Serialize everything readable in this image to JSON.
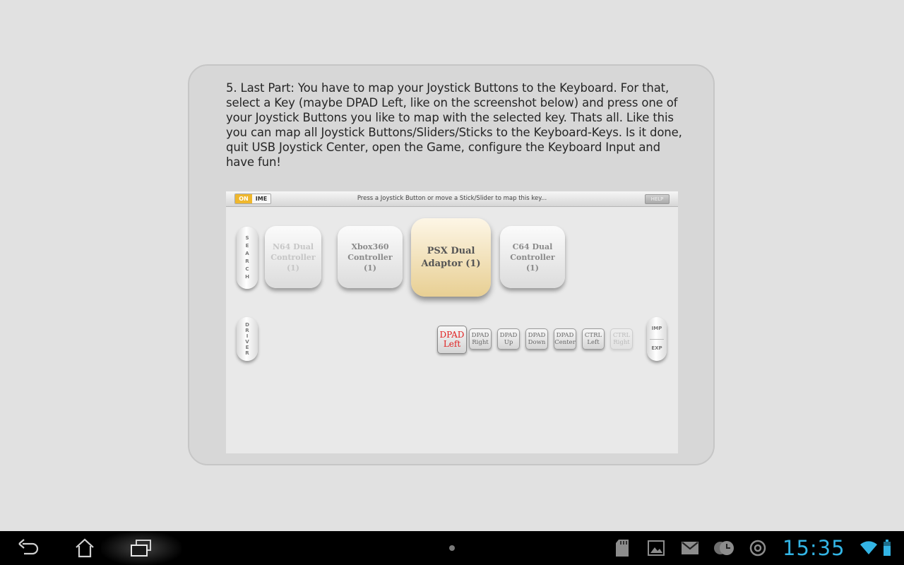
{
  "tutorial": {
    "text": "5. Last Part: You have to map your Joystick Buttons to the Keyboard. For that, select a Key (maybe DPAD Left, like on the screenshot below) and press one of your Joystick Buttons you like to map with the selected key. Thats all. Like this you can map all Joystick Buttons/Sliders/Sticks to the Keyboard-Keys. Is it done, quit USB Joystick Center, open the Game, configure the Keyboard Input and have fun!"
  },
  "screenshot": {
    "toggle_on": "ON",
    "toggle_ime": "IME",
    "prompt": "Press a Joystick Button or move a Stick/Slider to map this key...",
    "help": "HELP",
    "search_letters": [
      "S",
      "E",
      "A",
      "R",
      "C",
      "H"
    ],
    "driver_letters": [
      "D",
      "R",
      "I",
      "V",
      "E",
      "R"
    ],
    "controllers": [
      {
        "lines": [
          "N64 Dual",
          "Controller",
          "(1)"
        ],
        "state": "faded"
      },
      {
        "lines": [
          "Xbox360",
          "Controller",
          "(1)"
        ],
        "state": "normal"
      },
      {
        "lines": [
          "PSX Dual",
          "Adaptor (1)"
        ],
        "state": "selected"
      },
      {
        "lines": [
          "C64 Dual",
          "Controller",
          "(1)"
        ],
        "state": "normal"
      }
    ],
    "keys": [
      {
        "lines": [
          "DPAD",
          "Left"
        ],
        "state": "selected"
      },
      {
        "lines": [
          "DPAD",
          "Right"
        ],
        "state": "normal"
      },
      {
        "lines": [
          "DPAD",
          "Up"
        ],
        "state": "normal"
      },
      {
        "lines": [
          "DPAD",
          "Down"
        ],
        "state": "normal"
      },
      {
        "lines": [
          "DPAD",
          "Center"
        ],
        "state": "normal"
      },
      {
        "lines": [
          "CTRL",
          "Left"
        ],
        "state": "normal"
      },
      {
        "lines": [
          "CTRL",
          "Right"
        ],
        "state": "dim"
      }
    ],
    "imp": "IMP",
    "exp": "EXP"
  },
  "status_bar": {
    "time": "15:35",
    "accent_color": "#33b5e5",
    "notification_icons": [
      "sd-card-icon",
      "gallery-icon",
      "gmail-icon",
      "alarm-clock-icon",
      "asus-icon"
    ],
    "system_icons": [
      "wifi-icon",
      "battery-icon"
    ]
  },
  "nav_bar": {
    "buttons": [
      "back-icon",
      "home-icon",
      "recent-apps-icon"
    ]
  }
}
